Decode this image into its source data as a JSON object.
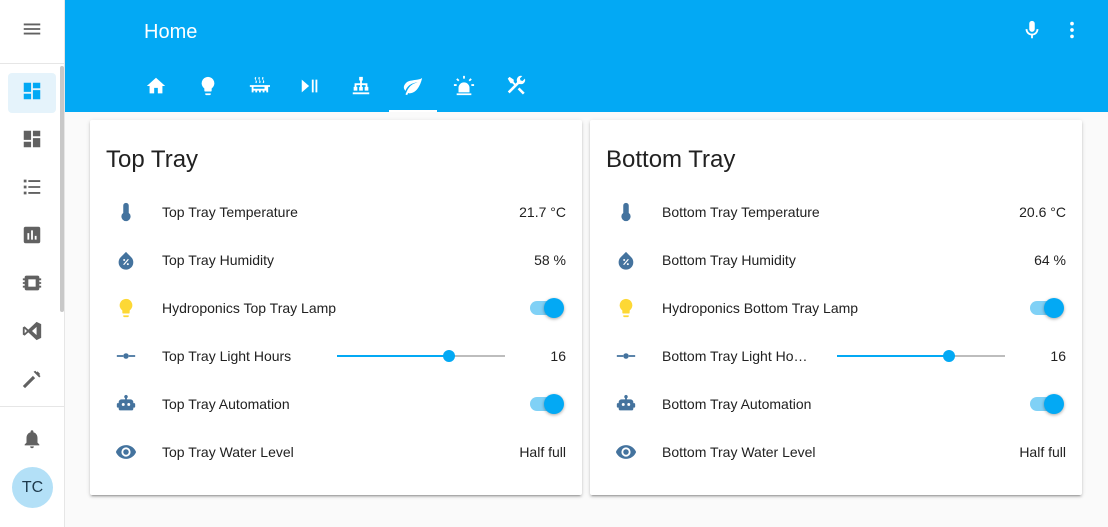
{
  "app": {
    "title": "Home"
  },
  "header": {
    "title": "Home",
    "icons": [
      "microphone-icon",
      "more-vertical-icon"
    ],
    "tabs": [
      {
        "icon": "home-icon"
      },
      {
        "icon": "lightbulb-icon"
      },
      {
        "icon": "radiator-icon"
      },
      {
        "icon": "play-pause-icon"
      },
      {
        "icon": "network-icon"
      },
      {
        "icon": "leaf-icon",
        "active": true
      },
      {
        "icon": "alarm-light-icon"
      },
      {
        "icon": "tools-icon"
      }
    ]
  },
  "sidebar": {
    "items": [
      {
        "icon": "menu-icon"
      },
      {
        "icon": "dashboard-icon",
        "active": true
      },
      {
        "icon": "dashboard-icon"
      },
      {
        "icon": "list-icon"
      },
      {
        "icon": "chart-box-icon"
      },
      {
        "icon": "chip-icon"
      },
      {
        "icon": "vscode-icon"
      },
      {
        "icon": "hammer-icon"
      },
      {
        "icon": "bell-icon"
      }
    ],
    "avatar": "TC"
  },
  "colors": {
    "accent": "#03a9f4",
    "icon": "#44739e",
    "lamp": "#fdd835",
    "text": "#212121"
  },
  "cards": [
    {
      "title": "Top Tray",
      "rows": [
        {
          "icon": "thermometer-icon",
          "name": "Top Tray Temperature",
          "value": "21.7 °C"
        },
        {
          "icon": "water-percent-icon",
          "name": "Top Tray Humidity",
          "value": "58 %"
        },
        {
          "icon": "lightbulb-icon",
          "name": "Hydroponics Top Tray Lamp",
          "toggle": true
        },
        {
          "icon": "ray-vertex-icon",
          "name": "Top Tray Light Hours",
          "value": "16",
          "slider": 0.667
        },
        {
          "icon": "robot-icon",
          "name": "Top Tray Automation",
          "toggle": true
        },
        {
          "icon": "eye-icon",
          "name": "Top Tray Water Level",
          "value": "Half full"
        }
      ]
    },
    {
      "title": "Bottom Tray",
      "rows": [
        {
          "icon": "thermometer-icon",
          "name": "Bottom Tray Temperature",
          "value": "20.6 °C"
        },
        {
          "icon": "water-percent-icon",
          "name": "Bottom Tray Humidity",
          "value": "64 %"
        },
        {
          "icon": "lightbulb-icon",
          "name": "Hydroponics Bottom Tray Lamp",
          "toggle": true
        },
        {
          "icon": "ray-vertex-icon",
          "name": "Bottom Tray Light Hou…",
          "value": "16",
          "slider": 0.667
        },
        {
          "icon": "robot-icon",
          "name": "Bottom Tray Automation",
          "toggle": true
        },
        {
          "icon": "eye-icon",
          "name": "Bottom Tray Water Level",
          "value": "Half full"
        }
      ]
    }
  ]
}
